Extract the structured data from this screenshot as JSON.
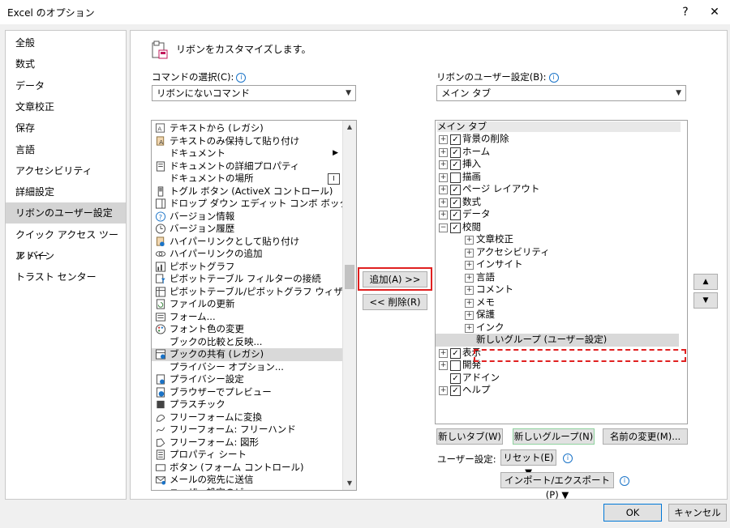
{
  "window": {
    "title": "Excel のオプション",
    "help": "?",
    "close": "✕"
  },
  "sidebar": {
    "items": [
      {
        "label": "全般"
      },
      {
        "label": "数式"
      },
      {
        "label": "データ"
      },
      {
        "label": "文章校正"
      },
      {
        "label": "保存"
      },
      {
        "label": "言語"
      },
      {
        "label": "アクセシビリティ"
      },
      {
        "label": "詳細設定"
      },
      {
        "label": "リボンのユーザー設定",
        "selected": true
      },
      {
        "label": "クイック アクセス ツール バー"
      },
      {
        "label": "アドイン"
      },
      {
        "label": "トラスト センター"
      }
    ]
  },
  "main": {
    "heading": "リボンをカスタマイズします。",
    "commands_label": "コマンドの選択(C):",
    "commands_combo": "リボンにないコマンド",
    "ribbon_label": "リボンのユーザー設定(B):",
    "ribbon_combo": "メイン タブ",
    "info_icon": "i"
  },
  "commands": [
    {
      "label": "テキストから (レガシ)",
      "icon": "text-import-icon"
    },
    {
      "label": "テキストのみ保持して貼り付け",
      "icon": "paste-text-icon"
    },
    {
      "label": "ドキュメント",
      "icon": "",
      "submenu": true
    },
    {
      "label": "ドキュメントの詳細プロパティ",
      "icon": "doc-properties-icon"
    },
    {
      "label": "ドキュメントの場所",
      "icon": "",
      "extra": "location-box-icon"
    },
    {
      "label": "トグル ボタン (ActiveX コントロール)",
      "icon": "toggle-button-icon"
    },
    {
      "label": "ドロップ ダウン エディット コンボ ボックス (...",
      "icon": "combo-box-icon"
    },
    {
      "label": "バージョン情報",
      "icon": "help-circle-icon"
    },
    {
      "label": "バージョン履歴",
      "icon": "history-icon"
    },
    {
      "label": "ハイパーリンクとして貼り付け",
      "icon": "paste-link-icon"
    },
    {
      "label": "ハイパーリンクの追加",
      "icon": "hyperlink-icon"
    },
    {
      "label": "ピボットグラフ",
      "icon": "pivot-chart-icon"
    },
    {
      "label": "ピボットテーブル フィルターの接続",
      "icon": "pivot-filter-icon"
    },
    {
      "label": "ピボットテーブル/ピボットグラフ ウィザード",
      "icon": "pivot-wizard-icon"
    },
    {
      "label": "ファイルの更新",
      "icon": "refresh-file-icon"
    },
    {
      "label": "フォーム...",
      "icon": "form-icon"
    },
    {
      "label": "フォント色の変更",
      "icon": "palette-icon"
    },
    {
      "label": "ブックの比較と反映...",
      "icon": ""
    },
    {
      "label": "ブックの共有 (レガシ)",
      "icon": "share-workbook-icon",
      "selected": true
    },
    {
      "label": "プライバシー オプション...",
      "icon": ""
    },
    {
      "label": "プライバシー設定",
      "icon": "privacy-icon"
    },
    {
      "label": "ブラウザーでプレビュー",
      "icon": "browser-preview-icon"
    },
    {
      "label": "プラスチック",
      "icon": "plastic-icon"
    },
    {
      "label": "フリーフォームに変換",
      "icon": "freeform-convert-icon"
    },
    {
      "label": "フリーフォーム: フリーハンド",
      "icon": "freehand-icon"
    },
    {
      "label": "フリーフォーム: 図形",
      "icon": "freeform-shape-icon"
    },
    {
      "label": "プロパティ シート",
      "icon": "property-sheet-icon"
    },
    {
      "label": "ボタン (フォーム コントロール)",
      "icon": "form-button-icon"
    },
    {
      "label": "メールの宛先に送信",
      "icon": "mail-icon"
    },
    {
      "label": "ユーザー設定のビュ...",
      "icon": ""
    }
  ],
  "ribbon_tree": {
    "header": "メイン タブ",
    "items": [
      {
        "label": "背景の削除",
        "level": 0,
        "expand": "+",
        "checked": true
      },
      {
        "label": "ホーム",
        "level": 0,
        "expand": "+",
        "checked": true
      },
      {
        "label": "挿入",
        "level": 0,
        "expand": "+",
        "checked": true
      },
      {
        "label": "描画",
        "level": 0,
        "expand": "+",
        "checked": false
      },
      {
        "label": "ページ レイアウト",
        "level": 0,
        "expand": "+",
        "checked": true
      },
      {
        "label": "数式",
        "level": 0,
        "expand": "+",
        "checked": true
      },
      {
        "label": "データ",
        "level": 0,
        "expand": "+",
        "checked": true
      },
      {
        "label": "校閲",
        "level": 0,
        "expand": "−",
        "checked": true
      },
      {
        "label": "文章校正",
        "level": 1,
        "expand": "+"
      },
      {
        "label": "アクセシビリティ",
        "level": 1,
        "expand": "+"
      },
      {
        "label": "インサイト",
        "level": 1,
        "expand": "+"
      },
      {
        "label": "言語",
        "level": 1,
        "expand": "+"
      },
      {
        "label": "コメント",
        "level": 1,
        "expand": "+"
      },
      {
        "label": "メモ",
        "level": 1,
        "expand": "+"
      },
      {
        "label": "保護",
        "level": 1,
        "expand": "+"
      },
      {
        "label": "インク",
        "level": 1,
        "expand": "+"
      },
      {
        "label": "新しいグループ (ユーザー設定)",
        "level": 1,
        "expand": "",
        "highlight": true
      },
      {
        "label": "表示",
        "level": 0,
        "expand": "+",
        "checked": true
      },
      {
        "label": "開発",
        "level": 0,
        "expand": "+",
        "checked": false
      },
      {
        "label": "アドイン",
        "level": 0,
        "expand": "",
        "checked": true
      },
      {
        "label": "ヘルプ",
        "level": 0,
        "expand": "+",
        "checked": true
      }
    ]
  },
  "buttons": {
    "add": "追加(A) >>",
    "remove": "<< 削除(R)",
    "new_tab": "新しいタブ(W)",
    "new_group": "新しいグループ(N)",
    "rename": "名前の変更(M)...",
    "user_settings_label": "ユーザー設定:",
    "reset": "リセット(E) ▼",
    "import_export": "インポート/エクスポート(P) ▼",
    "ok": "OK",
    "cancel": "キャンセル",
    "move_up": "▲",
    "move_down": "▼"
  },
  "colors": {
    "accent": "#0078d7",
    "highlight_red": "#e02020",
    "selection": "#d9d9d9"
  }
}
